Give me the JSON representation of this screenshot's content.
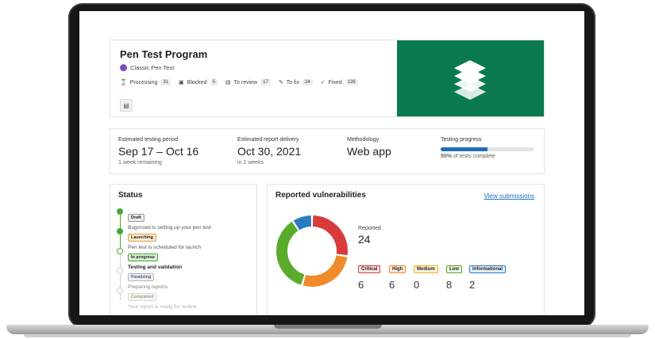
{
  "header": {
    "title": "Pen Test Program",
    "subtitle": "Classic Pen Test",
    "chips": [
      {
        "label": "Processing",
        "count": "31"
      },
      {
        "label": "Blocked",
        "count": "5"
      },
      {
        "label": "To review",
        "count": "17"
      },
      {
        "label": "To fix",
        "count": "24"
      },
      {
        "label": "Fixed",
        "count": "139"
      }
    ],
    "banner_color": "#0b7a4f"
  },
  "info": {
    "period_label": "Estimated testing period",
    "period_value": "Sep 17 – Oct 16",
    "period_note": "1 week remaining",
    "delivery_label": "Estimated report delivery",
    "delivery_value": "Oct 30, 2021",
    "delivery_note": "in 2 weeks",
    "method_label": "Methodology",
    "method_value": "Web app",
    "progress_label": "Testing progress",
    "progress_percent": 50,
    "progress_note_bold": "50%",
    "progress_note": " of tests complete"
  },
  "status": {
    "title": "Status",
    "steps": [
      {
        "tag": "Draft",
        "text": "Bugcrowd is setting up your pen test"
      },
      {
        "tag": "Launching",
        "text": "Pen test is scheduled for launch"
      },
      {
        "tag": "In progress",
        "text": "Testing and validation"
      },
      {
        "tag": "Finalizing",
        "text": "Preparing reports"
      },
      {
        "tag": "Completed",
        "text": "Your report is ready for review"
      }
    ]
  },
  "vulnerabilities": {
    "title": "Reported vulnerabilities",
    "link": "View submissions",
    "reported_label": "Reported",
    "reported_total": "24",
    "severities": [
      {
        "label": "Critical",
        "count": "6",
        "color": "#d93b3b"
      },
      {
        "label": "High",
        "count": "6",
        "color": "#f08a2a"
      },
      {
        "label": "Medium",
        "count": "0",
        "color": "#f0b32a"
      },
      {
        "label": "Low",
        "count": "8",
        "color": "#5aab2b"
      },
      {
        "label": "Informational",
        "count": "2",
        "color": "#2a7cc0"
      }
    ]
  }
}
